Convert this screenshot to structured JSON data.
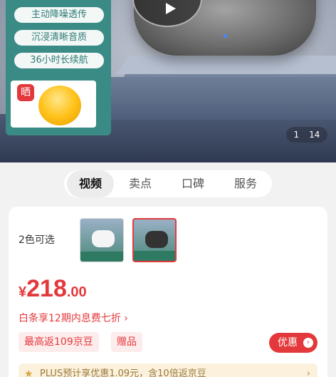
{
  "gallery": {
    "features": [
      "主动降噪透传",
      "沉浸清晰音质",
      "36小时长续航"
    ],
    "badge": "晒",
    "page_current": "1",
    "page_total": "14"
  },
  "tabs": [
    {
      "label": "视频",
      "active": true
    },
    {
      "label": "卖点",
      "active": false
    },
    {
      "label": "口碑",
      "active": false
    },
    {
      "label": "服务",
      "active": false
    }
  ],
  "product": {
    "color_label": "2色可选",
    "price_currency": "¥",
    "price_integer": "218",
    "price_decimal": ".00",
    "installment": "白条享12期内息费七折 ›",
    "promos": [
      "最高返109京豆",
      "赠品"
    ],
    "coupon_label": "优惠",
    "plus_text": "PLUS预计享优惠1.09元，含10倍返京豆"
  },
  "colors": {
    "accent": "#e4393c",
    "panel": "#3a8a86"
  }
}
